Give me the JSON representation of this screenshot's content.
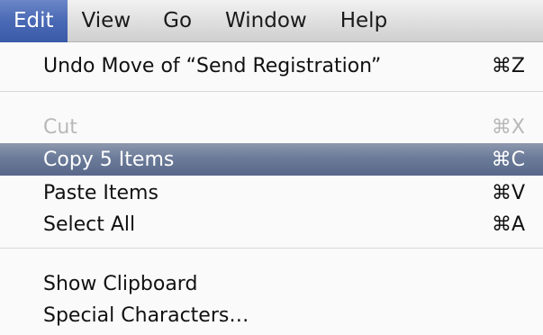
{
  "menubar": {
    "items": [
      {
        "label": "Edit",
        "active": true
      },
      {
        "label": "View"
      },
      {
        "label": "Go"
      },
      {
        "label": "Window"
      },
      {
        "label": "Help"
      }
    ]
  },
  "edit_menu": {
    "undo": {
      "label": "Undo Move of “Send Registration”",
      "shortcut": "⌘Z"
    },
    "cut": {
      "label": "Cut",
      "shortcut": "⌘X",
      "enabled": false
    },
    "copy": {
      "label": "Copy 5 Items",
      "shortcut": "⌘C",
      "highlighted": true
    },
    "paste": {
      "label": "Paste Items",
      "shortcut": "⌘V"
    },
    "select_all": {
      "label": "Select All",
      "shortcut": "⌘A"
    },
    "show_clipboard": {
      "label": "Show Clipboard"
    },
    "special_characters": {
      "label": "Special Characters…"
    }
  },
  "colors": {
    "active_menu_title": "#4a69b5",
    "highlight": "#6b7b99",
    "disabled_text": "#b8b8b8"
  }
}
